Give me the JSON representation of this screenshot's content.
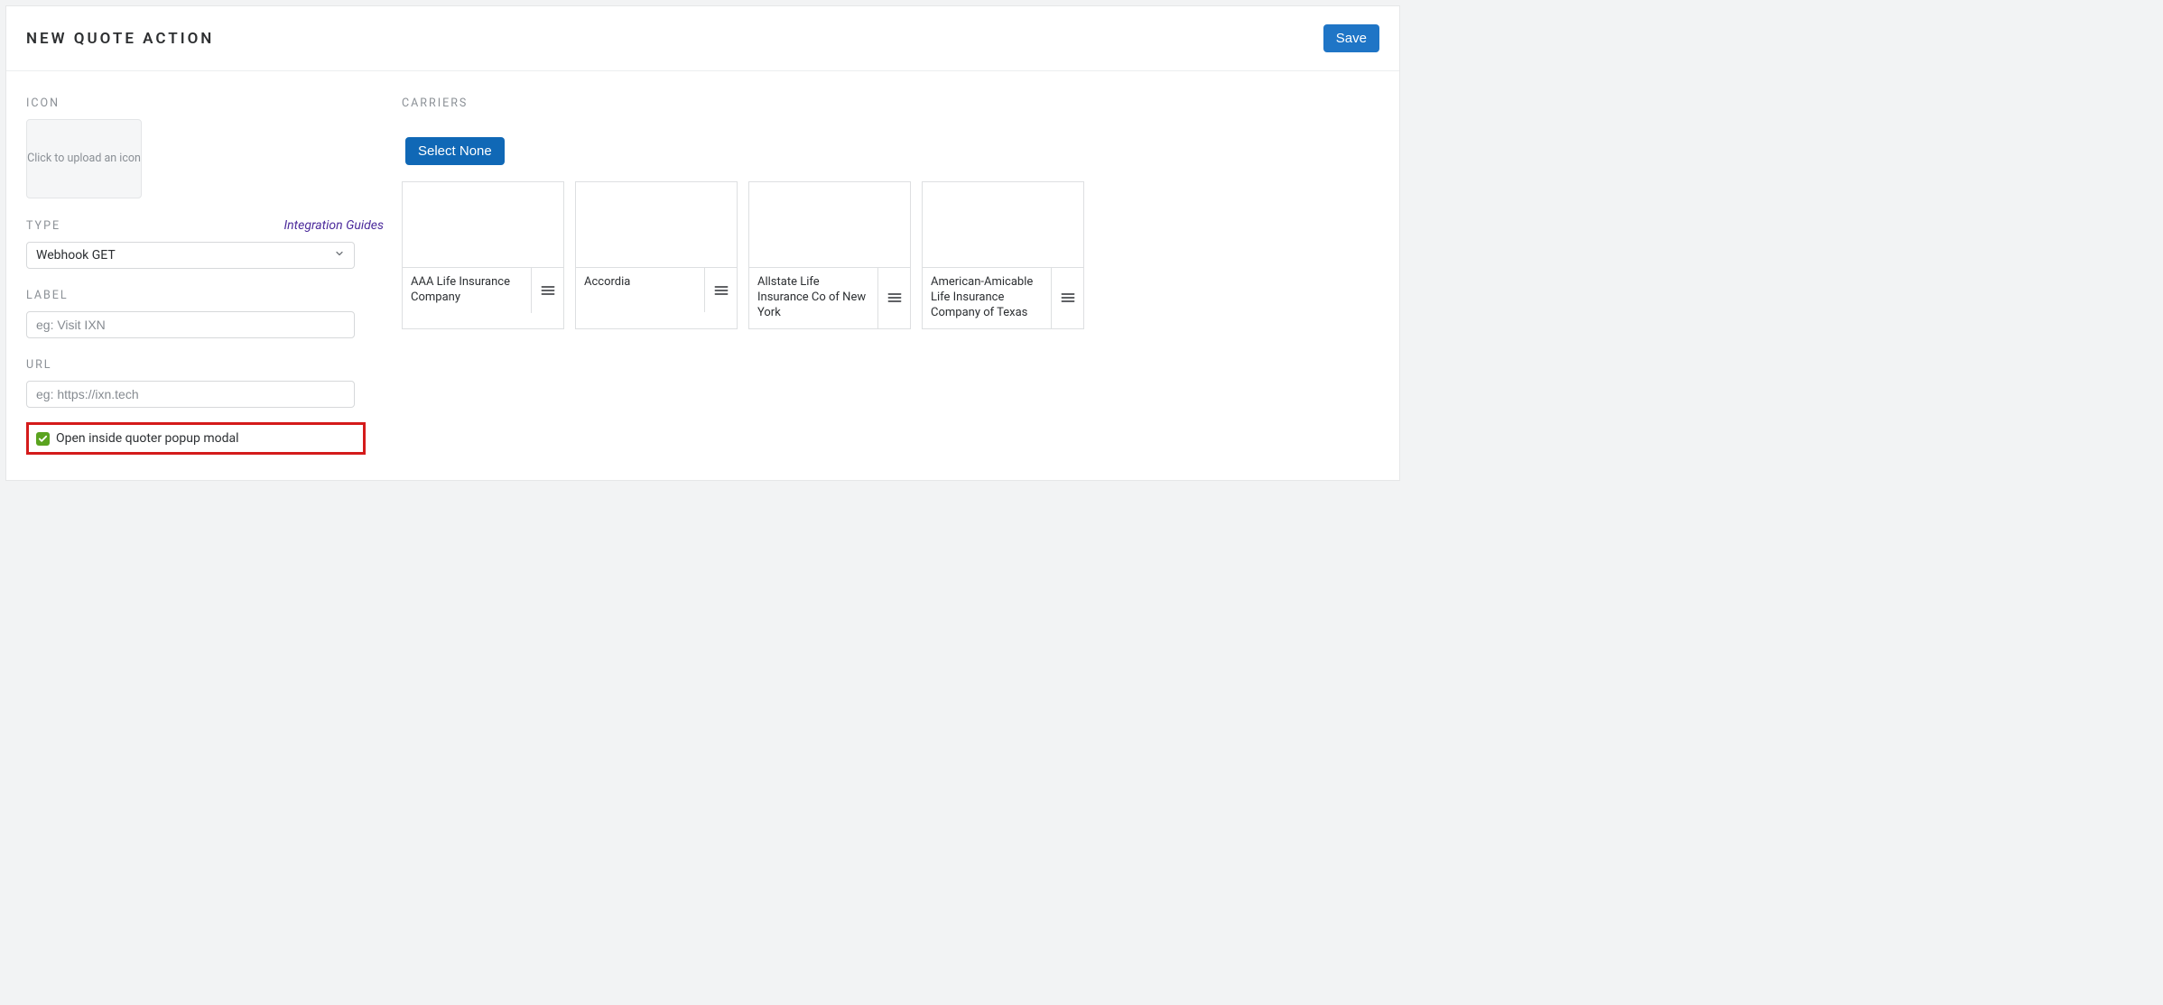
{
  "header": {
    "title": "NEW QUOTE ACTION",
    "save_label": "Save"
  },
  "left": {
    "icon_label": "ICON",
    "icon_upload_text": "Click to upload an icon",
    "type_label": "TYPE",
    "integration_link": "Integration Guides",
    "type_value": "Webhook GET",
    "label_label": "LABEL",
    "label_placeholder": "eg: Visit IXN",
    "label_value": "",
    "url_label": "URL",
    "url_placeholder": "eg: https://ixn.tech",
    "url_value": "",
    "checkbox_label": "Open inside quoter popup modal",
    "checkbox_checked": true
  },
  "right": {
    "carriers_label": "CARRIERS",
    "select_none_label": "Select None",
    "carriers": [
      {
        "name": "AAA Life Insurance Company"
      },
      {
        "name": "Accordia"
      },
      {
        "name": "Allstate Life Insurance Co of New York"
      },
      {
        "name": "American-Amicable Life Insurance Company of Texas"
      }
    ]
  }
}
